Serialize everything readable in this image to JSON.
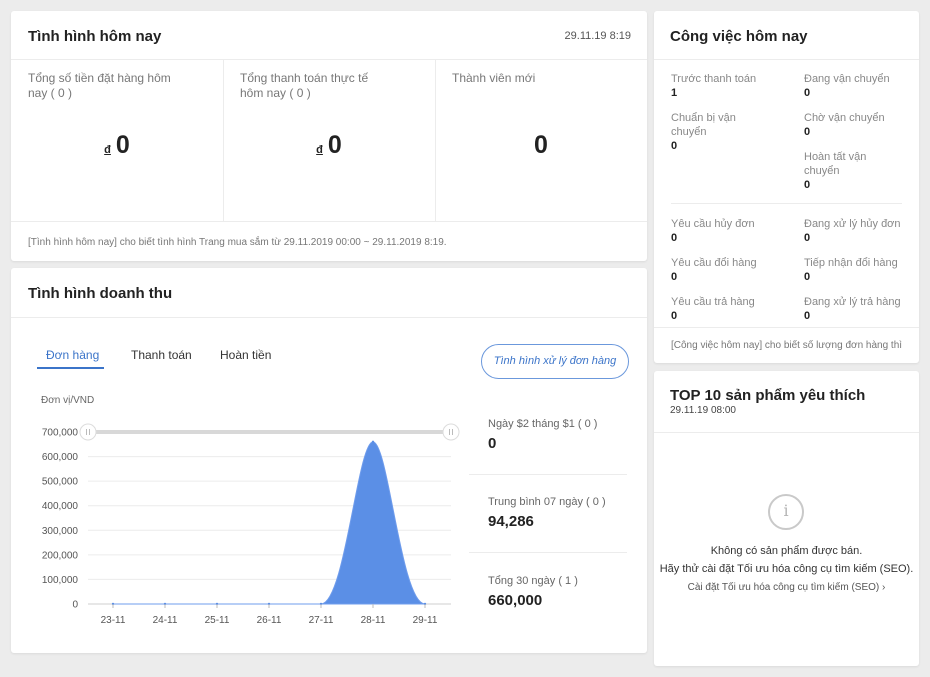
{
  "today": {
    "title": "Tình hình hôm nay",
    "timestamp": "29.11.19 8:19",
    "metrics": [
      {
        "label": "Tổng số tiền đặt hàng hôm nay ( 0 )",
        "currency": "đ",
        "value": "0"
      },
      {
        "label": "Tổng thanh toán thực tế hôm nay ( 0 )",
        "currency": "đ",
        "value": "0"
      },
      {
        "label": "Thành viên mới",
        "value": "0"
      }
    ],
    "footer": "[Tình hình hôm nay] cho biết tình hình Trang mua sắm từ 29.11.2019 00:00 ~ 29.11.2019 8:19."
  },
  "revenue": {
    "title": "Tình hình doanh thu",
    "tabs": [
      "Đơn hàng",
      "Thanh toán",
      "Hoàn tiền"
    ],
    "active_tab": 0,
    "button_label": "Tình hình xử lý đơn hàng",
    "unit_label": "Đơn vị/VND",
    "stats": [
      {
        "label": "Ngày $2 tháng $1 ( 0 )",
        "value": "0"
      },
      {
        "label": "Trung bình 07 ngày ( 0 )",
        "value": "94,286"
      },
      {
        "label": "Tổng 30 ngày ( 1 )",
        "value": "660,000"
      }
    ]
  },
  "chart_data": {
    "type": "area",
    "title": "",
    "xlabel": "",
    "ylabel": "Đơn vị/VND",
    "categories": [
      "23-11",
      "24-11",
      "25-11",
      "26-11",
      "27-11",
      "28-11",
      "29-11"
    ],
    "values": [
      0,
      0,
      0,
      0,
      0,
      660000,
      0
    ],
    "ylim": [
      0,
      700000
    ],
    "yticks": [
      0,
      100000,
      200000,
      300000,
      400000,
      500000,
      600000,
      700000
    ],
    "ytick_labels": [
      "0",
      "100,000",
      "200,000",
      "300,000",
      "400,000",
      "500,000",
      "600,000",
      "700,000"
    ],
    "color": "#5b8fe6",
    "grid": true
  },
  "tasks": {
    "title": "Công việc hôm nay",
    "items": [
      {
        "label": "Trước thanh toán",
        "value": "1"
      },
      {
        "label": "Đang vận chuyển",
        "value": "0"
      },
      {
        "label": "Chuẩn bị vận chuyển",
        "value": "0"
      },
      {
        "label": "Chờ vận chuyển",
        "value": "0"
      },
      {
        "label": "Hoàn tất vận chuyển",
        "value": "0"
      },
      {
        "label": "Yêu cầu hủy đơn",
        "value": "0"
      },
      {
        "label": "Đang xử lý hủy đơn",
        "value": "0"
      },
      {
        "label": "Yêu cầu đổi hàng",
        "value": "0"
      },
      {
        "label": "Tiếp nhận đổi hàng",
        "value": "0"
      },
      {
        "label": "Yêu cầu trả hàng",
        "value": "0"
      },
      {
        "label": "Đang xử lý trả hàng",
        "value": "0"
      }
    ],
    "footer": "[Công việc hôm nay] cho biết số lượng đơn hàng thì"
  },
  "top10": {
    "title": "TOP 10 sản phẩm yêu thích",
    "timestamp": "29.11.19 08:00",
    "empty_icon": "info-icon",
    "empty_line1": "Không có sản phẩm được bán.",
    "empty_line2": "Hãy thử cài đặt Tối ưu hóa công cụ tìm kiếm (SEO).",
    "empty_link": "Cài đặt Tối ưu hóa công cụ tìm kiếm (SEO)"
  }
}
